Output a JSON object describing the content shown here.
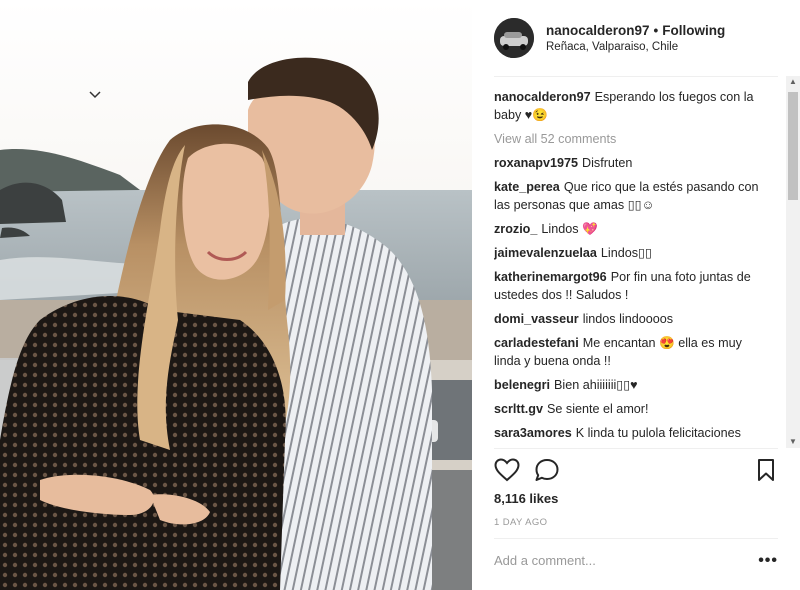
{
  "post": {
    "username": "nanocalderon97",
    "separator": "•",
    "follow_status": "Following",
    "location": "Reñaca, Valparaiso, Chile",
    "caption_user": "nanocalderon97",
    "caption_text": "Esperando los fuegos con la baby ♥😉",
    "view_all": "View all 52 comments",
    "likes": "8,116 likes",
    "time": "1 DAY AGO",
    "add_comment_placeholder": "Add a comment...",
    "more_label": "•••"
  },
  "comments": [
    {
      "user": "roxanapv1975",
      "text": "Disfruten"
    },
    {
      "user": "kate_perea",
      "text": "Que rico que la estés pasando con las personas que amas ▯▯☺"
    },
    {
      "user": "zrozio_",
      "text": "Lindos 💖"
    },
    {
      "user": "jaimevalenzuelaa",
      "text": "Lindos▯▯"
    },
    {
      "user": "katherinemargot96",
      "text": "Por fin una foto juntas de ustedes dos !! Saludos !"
    },
    {
      "user": "domi_vasseur",
      "text": "lindos lindoooos"
    },
    {
      "user": "carladestefani",
      "text": "Me encantan 😍 ella es muy linda y buena onda !!"
    },
    {
      "user": "belenegri",
      "text": "Bien ahiiiiiii▯▯♥"
    },
    {
      "user": "scrltt.gv",
      "text": "Se siente el amor!"
    },
    {
      "user": "sara3amores",
      "text": "K linda tu pulola felicitaciones mucho amor salud y platita este año k"
    }
  ],
  "icons": {
    "heart": "heart-icon",
    "comment": "comment-icon",
    "bookmark": "bookmark-icon",
    "scroll_up": "▲",
    "scroll_down": "▼"
  },
  "colors": {
    "text": "#262626",
    "muted": "#999999",
    "divider": "#efefef"
  }
}
